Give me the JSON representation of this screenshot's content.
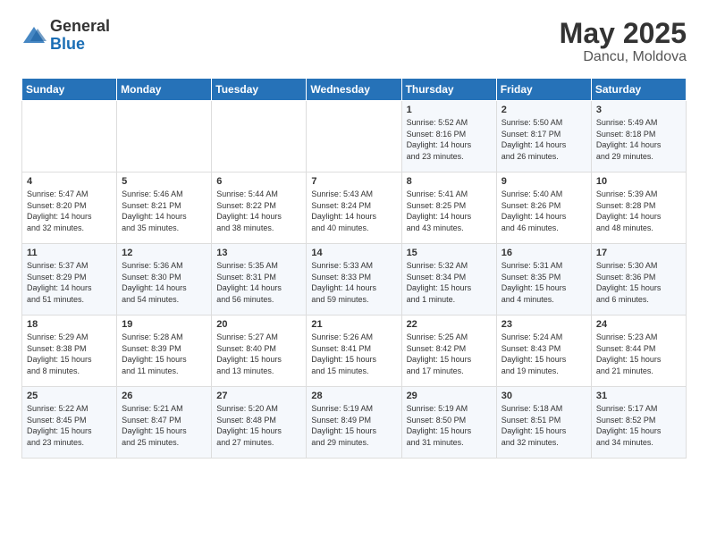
{
  "logo": {
    "general": "General",
    "blue": "Blue"
  },
  "title": {
    "month_year": "May 2025",
    "location": "Dancu, Moldova"
  },
  "weekdays": [
    "Sunday",
    "Monday",
    "Tuesday",
    "Wednesday",
    "Thursday",
    "Friday",
    "Saturday"
  ],
  "weeks": [
    [
      {
        "day": "",
        "info": ""
      },
      {
        "day": "",
        "info": ""
      },
      {
        "day": "",
        "info": ""
      },
      {
        "day": "",
        "info": ""
      },
      {
        "day": "1",
        "info": "Sunrise: 5:52 AM\nSunset: 8:16 PM\nDaylight: 14 hours\nand 23 minutes."
      },
      {
        "day": "2",
        "info": "Sunrise: 5:50 AM\nSunset: 8:17 PM\nDaylight: 14 hours\nand 26 minutes."
      },
      {
        "day": "3",
        "info": "Sunrise: 5:49 AM\nSunset: 8:18 PM\nDaylight: 14 hours\nand 29 minutes."
      }
    ],
    [
      {
        "day": "4",
        "info": "Sunrise: 5:47 AM\nSunset: 8:20 PM\nDaylight: 14 hours\nand 32 minutes."
      },
      {
        "day": "5",
        "info": "Sunrise: 5:46 AM\nSunset: 8:21 PM\nDaylight: 14 hours\nand 35 minutes."
      },
      {
        "day": "6",
        "info": "Sunrise: 5:44 AM\nSunset: 8:22 PM\nDaylight: 14 hours\nand 38 minutes."
      },
      {
        "day": "7",
        "info": "Sunrise: 5:43 AM\nSunset: 8:24 PM\nDaylight: 14 hours\nand 40 minutes."
      },
      {
        "day": "8",
        "info": "Sunrise: 5:41 AM\nSunset: 8:25 PM\nDaylight: 14 hours\nand 43 minutes."
      },
      {
        "day": "9",
        "info": "Sunrise: 5:40 AM\nSunset: 8:26 PM\nDaylight: 14 hours\nand 46 minutes."
      },
      {
        "day": "10",
        "info": "Sunrise: 5:39 AM\nSunset: 8:28 PM\nDaylight: 14 hours\nand 48 minutes."
      }
    ],
    [
      {
        "day": "11",
        "info": "Sunrise: 5:37 AM\nSunset: 8:29 PM\nDaylight: 14 hours\nand 51 minutes."
      },
      {
        "day": "12",
        "info": "Sunrise: 5:36 AM\nSunset: 8:30 PM\nDaylight: 14 hours\nand 54 minutes."
      },
      {
        "day": "13",
        "info": "Sunrise: 5:35 AM\nSunset: 8:31 PM\nDaylight: 14 hours\nand 56 minutes."
      },
      {
        "day": "14",
        "info": "Sunrise: 5:33 AM\nSunset: 8:33 PM\nDaylight: 14 hours\nand 59 minutes."
      },
      {
        "day": "15",
        "info": "Sunrise: 5:32 AM\nSunset: 8:34 PM\nDaylight: 15 hours\nand 1 minute."
      },
      {
        "day": "16",
        "info": "Sunrise: 5:31 AM\nSunset: 8:35 PM\nDaylight: 15 hours\nand 4 minutes."
      },
      {
        "day": "17",
        "info": "Sunrise: 5:30 AM\nSunset: 8:36 PM\nDaylight: 15 hours\nand 6 minutes."
      }
    ],
    [
      {
        "day": "18",
        "info": "Sunrise: 5:29 AM\nSunset: 8:38 PM\nDaylight: 15 hours\nand 8 minutes."
      },
      {
        "day": "19",
        "info": "Sunrise: 5:28 AM\nSunset: 8:39 PM\nDaylight: 15 hours\nand 11 minutes."
      },
      {
        "day": "20",
        "info": "Sunrise: 5:27 AM\nSunset: 8:40 PM\nDaylight: 15 hours\nand 13 minutes."
      },
      {
        "day": "21",
        "info": "Sunrise: 5:26 AM\nSunset: 8:41 PM\nDaylight: 15 hours\nand 15 minutes."
      },
      {
        "day": "22",
        "info": "Sunrise: 5:25 AM\nSunset: 8:42 PM\nDaylight: 15 hours\nand 17 minutes."
      },
      {
        "day": "23",
        "info": "Sunrise: 5:24 AM\nSunset: 8:43 PM\nDaylight: 15 hours\nand 19 minutes."
      },
      {
        "day": "24",
        "info": "Sunrise: 5:23 AM\nSunset: 8:44 PM\nDaylight: 15 hours\nand 21 minutes."
      }
    ],
    [
      {
        "day": "25",
        "info": "Sunrise: 5:22 AM\nSunset: 8:45 PM\nDaylight: 15 hours\nand 23 minutes."
      },
      {
        "day": "26",
        "info": "Sunrise: 5:21 AM\nSunset: 8:47 PM\nDaylight: 15 hours\nand 25 minutes."
      },
      {
        "day": "27",
        "info": "Sunrise: 5:20 AM\nSunset: 8:48 PM\nDaylight: 15 hours\nand 27 minutes."
      },
      {
        "day": "28",
        "info": "Sunrise: 5:19 AM\nSunset: 8:49 PM\nDaylight: 15 hours\nand 29 minutes."
      },
      {
        "day": "29",
        "info": "Sunrise: 5:19 AM\nSunset: 8:50 PM\nDaylight: 15 hours\nand 31 minutes."
      },
      {
        "day": "30",
        "info": "Sunrise: 5:18 AM\nSunset: 8:51 PM\nDaylight: 15 hours\nand 32 minutes."
      },
      {
        "day": "31",
        "info": "Sunrise: 5:17 AM\nSunset: 8:52 PM\nDaylight: 15 hours\nand 34 minutes."
      }
    ]
  ]
}
